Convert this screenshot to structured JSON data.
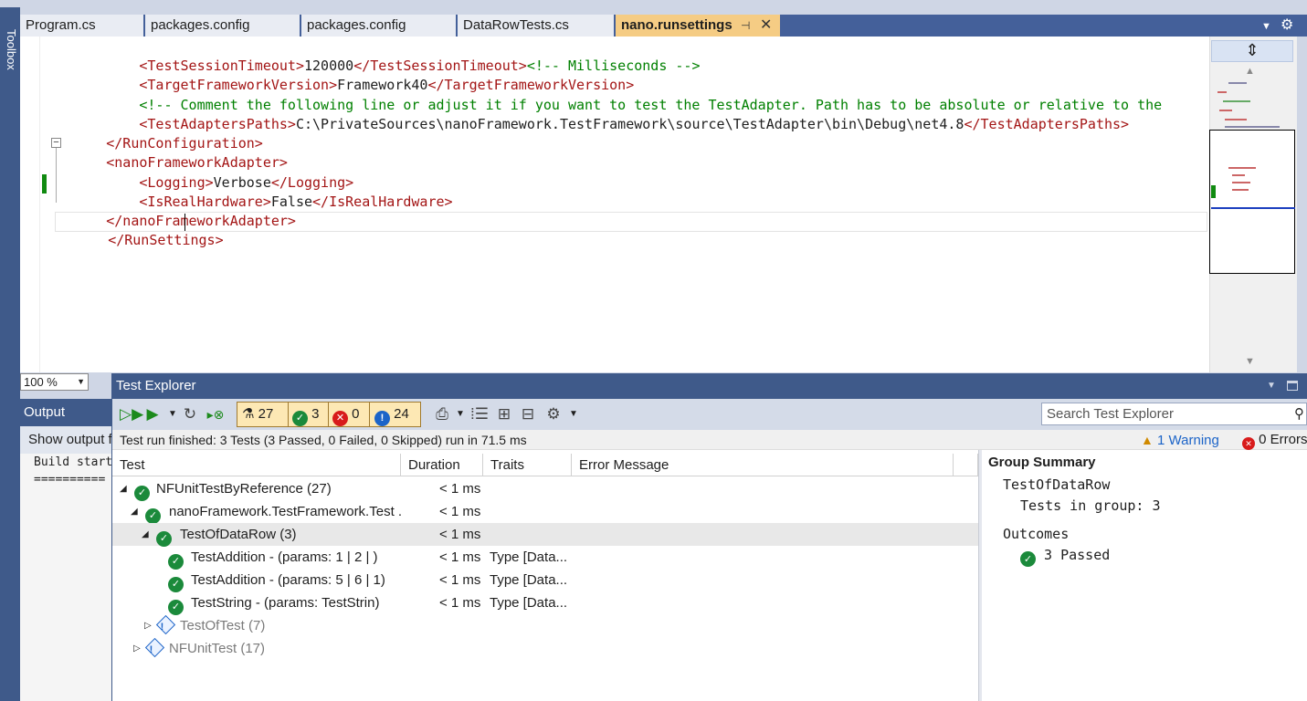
{
  "toolbox": {
    "label": "Toolbox"
  },
  "tabs": [
    {
      "label": "Program.cs",
      "active": false
    },
    {
      "label": "packages.config",
      "active": false
    },
    {
      "label": "packages.config",
      "active": false
    },
    {
      "label": "DataRowTests.cs",
      "active": false
    },
    {
      "label": "nano.runsettings",
      "active": true
    }
  ],
  "tab_icons": {
    "pin": "pin-icon",
    "close": "close-icon",
    "overflow": "chevron-down-icon",
    "settings": "gear-icon"
  },
  "editor": {
    "lines": [
      {
        "indent": "      ",
        "open": "<TestSessionTimeout>",
        "text": "120000",
        "close": "</TestSessionTimeout>",
        "comment": "<!-- Milliseconds -->"
      },
      {
        "indent": "      ",
        "open": "<TargetFrameworkVersion>",
        "text": "Framework40",
        "close": "</TargetFrameworkVersion>",
        "comment": ""
      },
      {
        "indent": "      ",
        "open": "",
        "text": "",
        "close": "",
        "comment": "<!-- Comment the following line or adjust it if you want to test the TestAdapter. Path has to be absolute or relative to the"
      },
      {
        "indent": "      ",
        "open": "<TestAdaptersPaths>",
        "text": "C:\\PrivateSources\\nanoFramework.TestFramework\\source\\TestAdapter\\bin\\Debug\\net4.8",
        "close": "</TestAdaptersPaths>",
        "comment": ""
      },
      {
        "indent": "  ",
        "open": "",
        "text": "",
        "close": "</RunConfiguration>",
        "comment": ""
      },
      {
        "indent": "  ",
        "open": "<nanoFrameworkAdapter>",
        "text": "",
        "close": "",
        "comment": ""
      },
      {
        "indent": "      ",
        "open": "<Logging>",
        "text": "Verbose",
        "close": "</Logging>",
        "comment": ""
      },
      {
        "indent": "      ",
        "open": "<IsRealHardware>",
        "text": "False",
        "close": "</IsRealHardware>",
        "comment": ""
      },
      {
        "indent": "  ",
        "open": "",
        "text": "",
        "close": "</nanoFrameworkAdapter>",
        "comment": ""
      },
      {
        "indent": "",
        "open": "",
        "text": "",
        "close": "</RunSettings>",
        "comment": ""
      }
    ],
    "zoom": "100 %",
    "split_icon": "split-icon"
  },
  "output": {
    "title": "Output",
    "show_output_from": "Show output f",
    "log": "Build start\n=========="
  },
  "test_explorer": {
    "title": "Test Explorer",
    "counts": {
      "total": "27",
      "passed": "3",
      "failed": "0",
      "not_run": "24"
    },
    "search_placeholder": "Search Test Explorer",
    "status": "Test run finished: 3 Tests (3 Passed, 0 Failed, 0 Skipped) run in 71.5 ms",
    "warnings": "1 Warning",
    "errors": "0 Errors",
    "columns": {
      "test": "Test",
      "duration": "Duration",
      "traits": "Traits",
      "error": "Error Message"
    },
    "rows": [
      {
        "name": "NFUnitTestByReference  (27)",
        "duration": "< 1 ms",
        "traits": "",
        "state": "passed",
        "level": 0,
        "expand": "open"
      },
      {
        "name": "nanoFramework.TestFramework.Test .",
        "duration": "< 1 ms",
        "traits": "",
        "state": "passed",
        "level": 1,
        "expand": "open"
      },
      {
        "name": "TestOfDataRow  (3)",
        "duration": "< 1 ms",
        "traits": "",
        "state": "passed",
        "level": 2,
        "expand": "open",
        "selected": true
      },
      {
        "name": "TestAddition - (params: 1 | 2 | )",
        "duration": "< 1 ms",
        "traits": "Type [Data...",
        "state": "passed",
        "level": 3,
        "expand": ""
      },
      {
        "name": "TestAddition - (params: 5 | 6 | 1)",
        "duration": "< 1 ms",
        "traits": "Type [Data...",
        "state": "passed",
        "level": 3,
        "expand": ""
      },
      {
        "name": "TestString - (params: TestStrin)",
        "duration": "< 1 ms",
        "traits": "Type [Data...",
        "state": "passed",
        "level": 3,
        "expand": ""
      },
      {
        "name": "TestOfTest  (7)",
        "duration": "",
        "traits": "",
        "state": "notrun",
        "level": 2,
        "expand": "closed"
      },
      {
        "name": "NFUnitTest  (17)",
        "duration": "",
        "traits": "",
        "state": "notrun",
        "level": 1,
        "expand": "closed"
      }
    ],
    "group_summary": {
      "title": "Group Summary",
      "group": "TestOfDataRow",
      "tests_label": "Tests in group:",
      "tests_count": "3",
      "outcomes_label": "Outcomes",
      "passed": "3 Passed"
    }
  }
}
